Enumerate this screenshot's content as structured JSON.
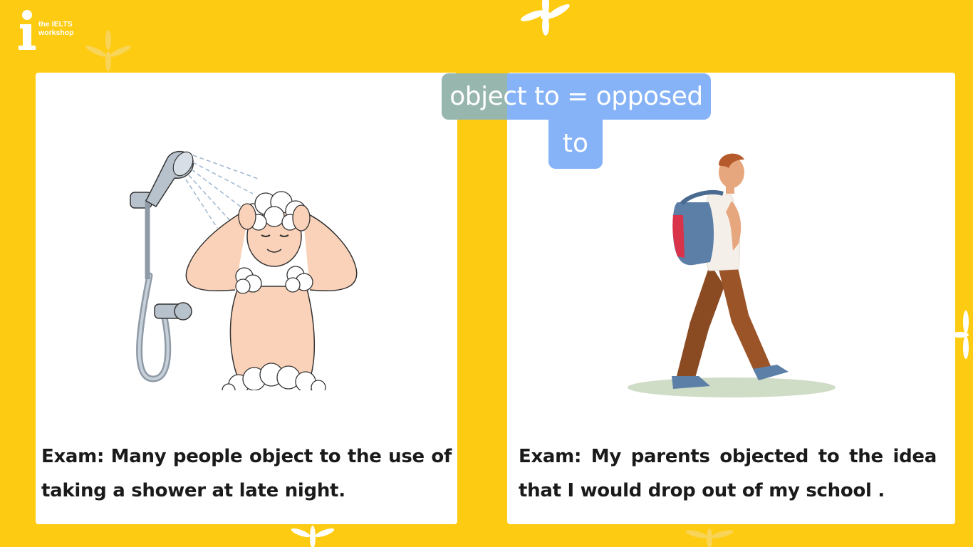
{
  "logo": {
    "line1_the": "the",
    "line1_ielts": "IELTS",
    "line2": "workshop"
  },
  "note": {
    "line1": "object to = opposed",
    "line2": "to"
  },
  "cards": [
    {
      "caption": "Exam: Many people object to the use of taking a shower at late night.",
      "illustration": "person-showering"
    },
    {
      "caption": "Exam: My parents objected to the idea that I would drop out of my school .",
      "illustration": "student-walking-with-backpack"
    }
  ],
  "colors": {
    "background": "#FDCB12",
    "card": "#FFFFFF",
    "note": "#86B3F7",
    "text": "#1A1A1A"
  }
}
